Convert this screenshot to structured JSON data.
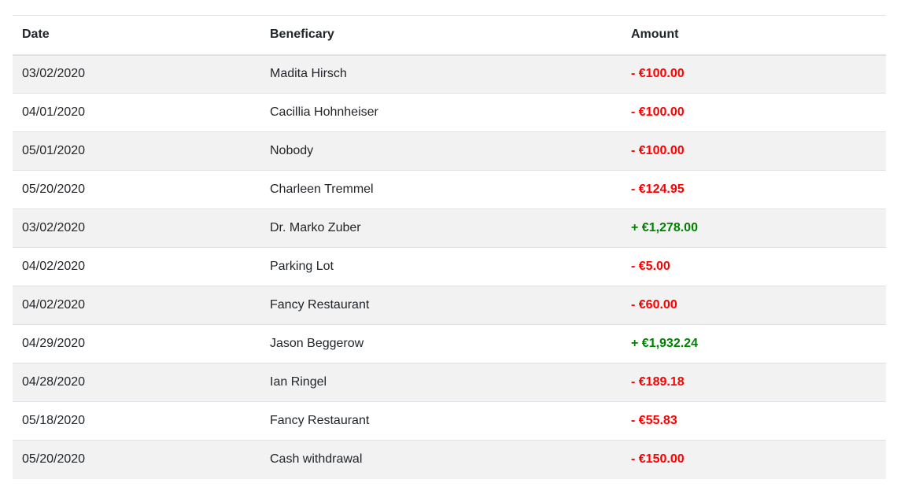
{
  "table": {
    "headers": {
      "date": "Date",
      "beneficiary": "Beneficary",
      "amount": "Amount"
    },
    "rows": [
      {
        "date": "03/02/2020",
        "beneficiary": "Madita Hirsch",
        "amount": "- €100.00",
        "sign": "negative"
      },
      {
        "date": "04/01/2020",
        "beneficiary": "Cacillia Hohnheiser",
        "amount": "- €100.00",
        "sign": "negative"
      },
      {
        "date": "05/01/2020",
        "beneficiary": "Nobody",
        "amount": "- €100.00",
        "sign": "negative"
      },
      {
        "date": "05/20/2020",
        "beneficiary": "Charleen Tremmel",
        "amount": "- €124.95",
        "sign": "negative"
      },
      {
        "date": "03/02/2020",
        "beneficiary": "Dr. Marko Zuber",
        "amount": "+ €1,278.00",
        "sign": "positive"
      },
      {
        "date": "04/02/2020",
        "beneficiary": "Parking Lot",
        "amount": "- €5.00",
        "sign": "negative"
      },
      {
        "date": "04/02/2020",
        "beneficiary": "Fancy Restaurant",
        "amount": "- €60.00",
        "sign": "negative"
      },
      {
        "date": "04/29/2020",
        "beneficiary": "Jason Beggerow",
        "amount": "+ €1,932.24",
        "sign": "positive"
      },
      {
        "date": "04/28/2020",
        "beneficiary": "Ian Ringel",
        "amount": "- €189.18",
        "sign": "negative"
      },
      {
        "date": "05/18/2020",
        "beneficiary": "Fancy Restaurant",
        "amount": "- €55.83",
        "sign": "negative"
      },
      {
        "date": "05/20/2020",
        "beneficiary": "Cash withdrawal",
        "amount": "- €150.00",
        "sign": "negative"
      }
    ]
  },
  "colors": {
    "negative": "#ff0000",
    "positive": "#008000",
    "stripe": "#f2f2f2",
    "border": "#dee2e6"
  }
}
